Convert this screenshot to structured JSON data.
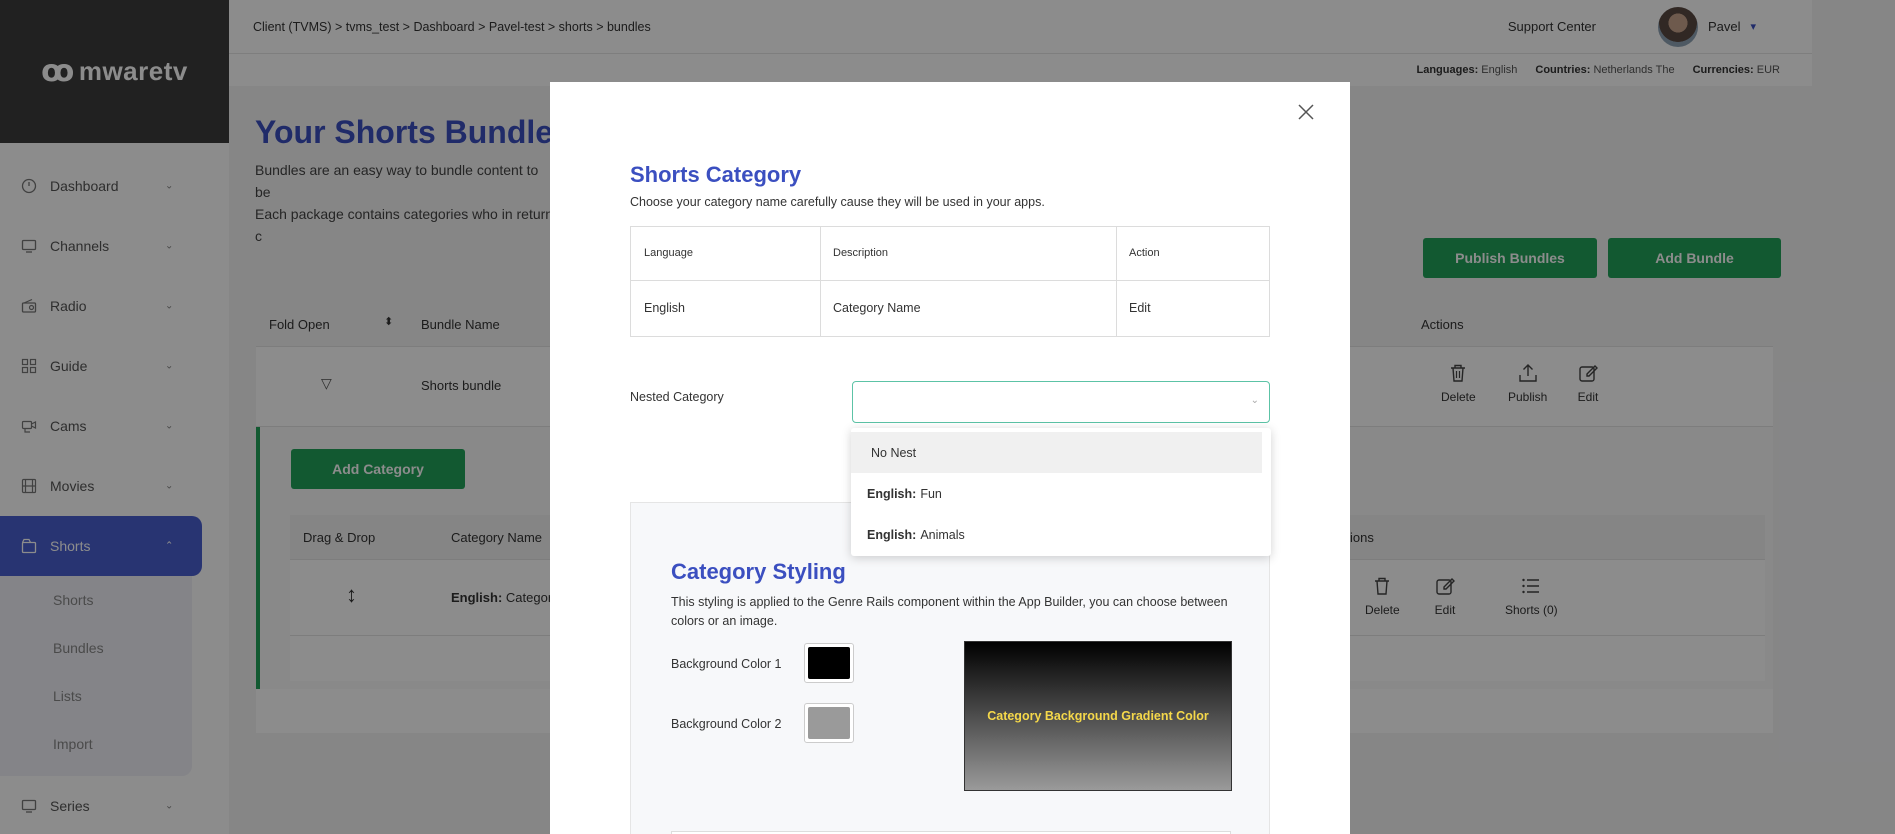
{
  "sidebar": {
    "logo": "mwaretv",
    "items": [
      {
        "label": "Dashboard",
        "icon": "speedometer-icon"
      },
      {
        "label": "Channels",
        "icon": "monitor-icon"
      },
      {
        "label": "Radio",
        "icon": "radio-icon"
      },
      {
        "label": "Guide",
        "icon": "grid-icon"
      },
      {
        "label": "Cams",
        "icon": "camera-icon"
      },
      {
        "label": "Movies",
        "icon": "film-icon"
      },
      {
        "label": "Shorts",
        "icon": "shorts-icon"
      },
      {
        "label": "Series",
        "icon": "series-icon"
      }
    ],
    "sub_items": [
      "Shorts",
      "Bundles",
      "Lists",
      "Import"
    ]
  },
  "topbar": {
    "breadcrumb": "Client (TVMS)  >  tvms_test  >  Dashboard  > Pavel-test > shorts > bundles",
    "support": "Support Center",
    "user": "Pavel"
  },
  "locale": {
    "languages_label": "Languages:",
    "languages": "English",
    "countries_label": "Countries:",
    "countries": "Netherlands The",
    "currencies_label": "Currencies:",
    "currencies": "EUR"
  },
  "page": {
    "title": "Your Shorts Bundles",
    "desc1": "Bundles are an easy way to bundle content to be",
    "desc2": "Each package contains categories who in return c",
    "publish_bundles": "Publish Bundles",
    "add_bundle": "Add Bundle"
  },
  "bundle_table": {
    "headers": {
      "fold": "Fold Open",
      "name": "Bundle Name",
      "actions": "Actions"
    },
    "row": {
      "name": "Shorts bundle",
      "delete": "Delete",
      "publish": "Publish",
      "edit": "Edit"
    }
  },
  "category_area": {
    "add_category": "Add Category",
    "headers": {
      "drag": "Drag & Drop",
      "name": "Category Name",
      "actions": "ions"
    },
    "row": {
      "lang": "English:",
      "name": "Category N",
      "delete": "Delete",
      "edit": "Edit",
      "shorts": "Shorts (0)"
    }
  },
  "modal": {
    "title": "Shorts Category",
    "subtitle": "Choose your category name carefully cause they will be used in your apps.",
    "table": {
      "headers": {
        "language": "Language",
        "description": "Description",
        "action": "Action"
      },
      "row": {
        "language": "English",
        "description": "Category Name",
        "action": "Edit"
      }
    },
    "nested_label": "Nested Category",
    "nested_value": "",
    "dropdown": [
      {
        "lang": "",
        "name": "No Nest"
      },
      {
        "lang": "English:",
        "name": "Fun"
      },
      {
        "lang": "English:",
        "name": "Animals"
      }
    ],
    "styling": {
      "title": "Category Styling",
      "desc": "This styling is applied to the Genre Rails component within the App Builder, you can choose between colors or an image.",
      "color1_label": "Background Color 1",
      "color1": "#000000",
      "color2_label": "Background Color 2",
      "color2": "#9a9a9a",
      "preview_text": "Category Background Gradient Color"
    }
  },
  "colors": {
    "accent": "#3b4fc0",
    "green": "#22a35a",
    "select_border": "#5cc3a6"
  }
}
